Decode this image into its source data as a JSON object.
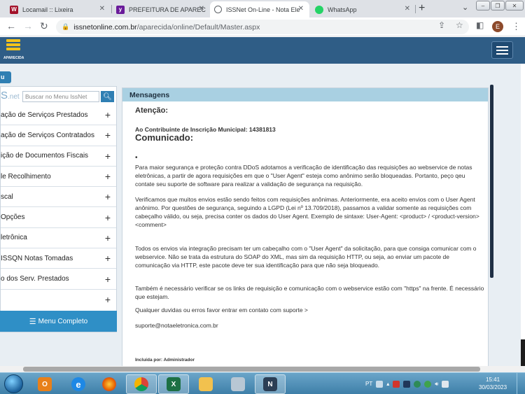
{
  "browser": {
    "tabs": [
      {
        "title": "Locamail :: Lixeira",
        "favicon": "W",
        "favicon_color": "#a3122a",
        "active": false
      },
      {
        "title": "PREFEITURA DE APARECIDA",
        "favicon": "y",
        "favicon_color": "#6a1b9a",
        "active": false
      },
      {
        "title": "ISSNet On-Line - Nota Ele",
        "favicon": "globe",
        "favicon_color": "#5f6368",
        "active": true
      },
      {
        "title": "WhatsApp",
        "favicon": "whatsapp",
        "favicon_color": "#25d366",
        "active": false
      }
    ],
    "new_tab": "+",
    "url_host": "issnetonline.com.br",
    "url_path": "/aparecida/online/Default/Master.aspx",
    "profile_initial": "E"
  },
  "site": {
    "logo_label": "APARECIDA"
  },
  "sidebar": {
    "tab_label": "u",
    "brand": "S",
    "brand_suffix": ".net",
    "search_placeholder": "Buscar no Menu IssNet",
    "items": [
      {
        "label": "ação de Serviços Prestados"
      },
      {
        "label": "ação de Serviços Contratados"
      },
      {
        "label": "ição de Documentos Fiscais"
      },
      {
        "label": "le Recolhimento"
      },
      {
        "label": "scal"
      },
      {
        "label": "Opções"
      },
      {
        "label": "letrônica"
      },
      {
        "label": "ISSQN Notas Tomadas"
      },
      {
        "label": "o dos Serv. Prestados"
      },
      {
        "label": ""
      }
    ],
    "full_menu_label": "Menu Completo"
  },
  "messages": {
    "header": "Mensagens",
    "attention": "Atenção:",
    "contributor": "Ao Contribuinte de Inscrição Municipal: 14381813",
    "title": "Comunicado:",
    "bullet": "•",
    "paragraphs": [
      "Para maior segurança e proteção contra DDoS adotamos a verificação de identificação das requisições ao webservice de notas eletrônicas, a partir de agora requisições em que o \"User Agent\" esteja como anônimo serão bloqueadas. Portanto, peço qeu contate seu suporte de software para realizar   a validação de segurança na requisição.",
      "Verificamos que muitos envios estão sendo feitos com requisições anônimas. Anteriormente, era aceito envios com o User Agent anônimo. Por questões de segurança, seguindo a LGPD (Lei nº 13.709/2018), passamos a validar somente as requisições com cabeçalho válido, ou seja, precisa conter os dados do User Agent. Exemplo de sintaxe: User-Agent: <product> / <product-version> <comment>",
      "Todos os envios via integração precisam ter um cabeçalho com o \"User Agent\" da solicitação, para que consiga comunicar com o webservice. Não se trata da estrutura do SOAP do XML, mas sim da requisição HTTP, ou seja, ao enviar um pacote  de comunicação via HTTP, este pacote deve ter sua identificação para que não seja bloqueado.",
      "Também é necessário verificar se os links de requisição e comunicação com o webservice estão com \"https\" na frente. É necessário que estejam.",
      "Qualquer duvidas ou erros favor entrar em contato com suporte >",
      "suporte@notaeletronica.com.br"
    ],
    "included_by": "Incluída por: Administrador"
  },
  "taskbar": {
    "language": "PT",
    "time": "15:41",
    "date": "30/03/2023",
    "apps": [
      {
        "name": "outlook-icon",
        "glyph": "O",
        "color": "#e8801a"
      },
      {
        "name": "internet-explorer-icon",
        "glyph": "e",
        "color": "#1e88e5"
      },
      {
        "name": "firefox-icon",
        "glyph": "",
        "color": "#e66000"
      },
      {
        "name": "chrome-icon",
        "glyph": "",
        "color": "#db4437"
      },
      {
        "name": "excel-icon",
        "glyph": "X",
        "color": "#1d7044"
      },
      {
        "name": "explorer-icon",
        "glyph": "",
        "color": "#f2c14e"
      },
      {
        "name": "calculator-icon",
        "glyph": "",
        "color": "#b8c7d4"
      },
      {
        "name": "app-n-icon",
        "glyph": "N",
        "color": "#2b3e55"
      }
    ]
  }
}
